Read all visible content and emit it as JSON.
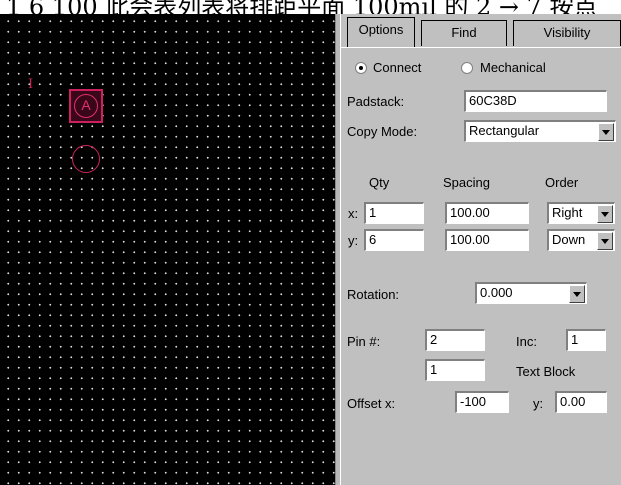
{
  "caption": "1 6 100 此会表列表将排距平面 100mil 的 2 → 7 按点",
  "canvas": {
    "mark": "I",
    "pad_label": "A"
  },
  "tabs": [
    {
      "label": "Options"
    },
    {
      "label": "Find"
    },
    {
      "label": "Visibility"
    }
  ],
  "mode": {
    "connect_label": "Connect",
    "mechanical_label": "Mechanical",
    "selected": "Connect"
  },
  "padstack": {
    "label": "Padstack:",
    "value": "60C38D"
  },
  "copy_mode": {
    "label": "Copy Mode:",
    "value": "Rectangular"
  },
  "grid": {
    "qty_header": "Qty",
    "spacing_header": "Spacing",
    "order_header": "Order",
    "x": {
      "label": "x:",
      "qty": "1",
      "spacing": "100.00",
      "order": "Right"
    },
    "y": {
      "label": "y:",
      "qty": "6",
      "spacing": "100.00",
      "order": "Down"
    }
  },
  "rotation": {
    "label": "Rotation:",
    "value": "0.000"
  },
  "pin": {
    "label": "Pin #:",
    "value": "2",
    "inc_label": "Inc:",
    "inc_value": "1",
    "text_block_value": "1",
    "text_block_label": "Text Block"
  },
  "offset": {
    "x_label": "Offset x:",
    "x_value": "-100",
    "y_label": "y:",
    "y_value": "0.00"
  }
}
